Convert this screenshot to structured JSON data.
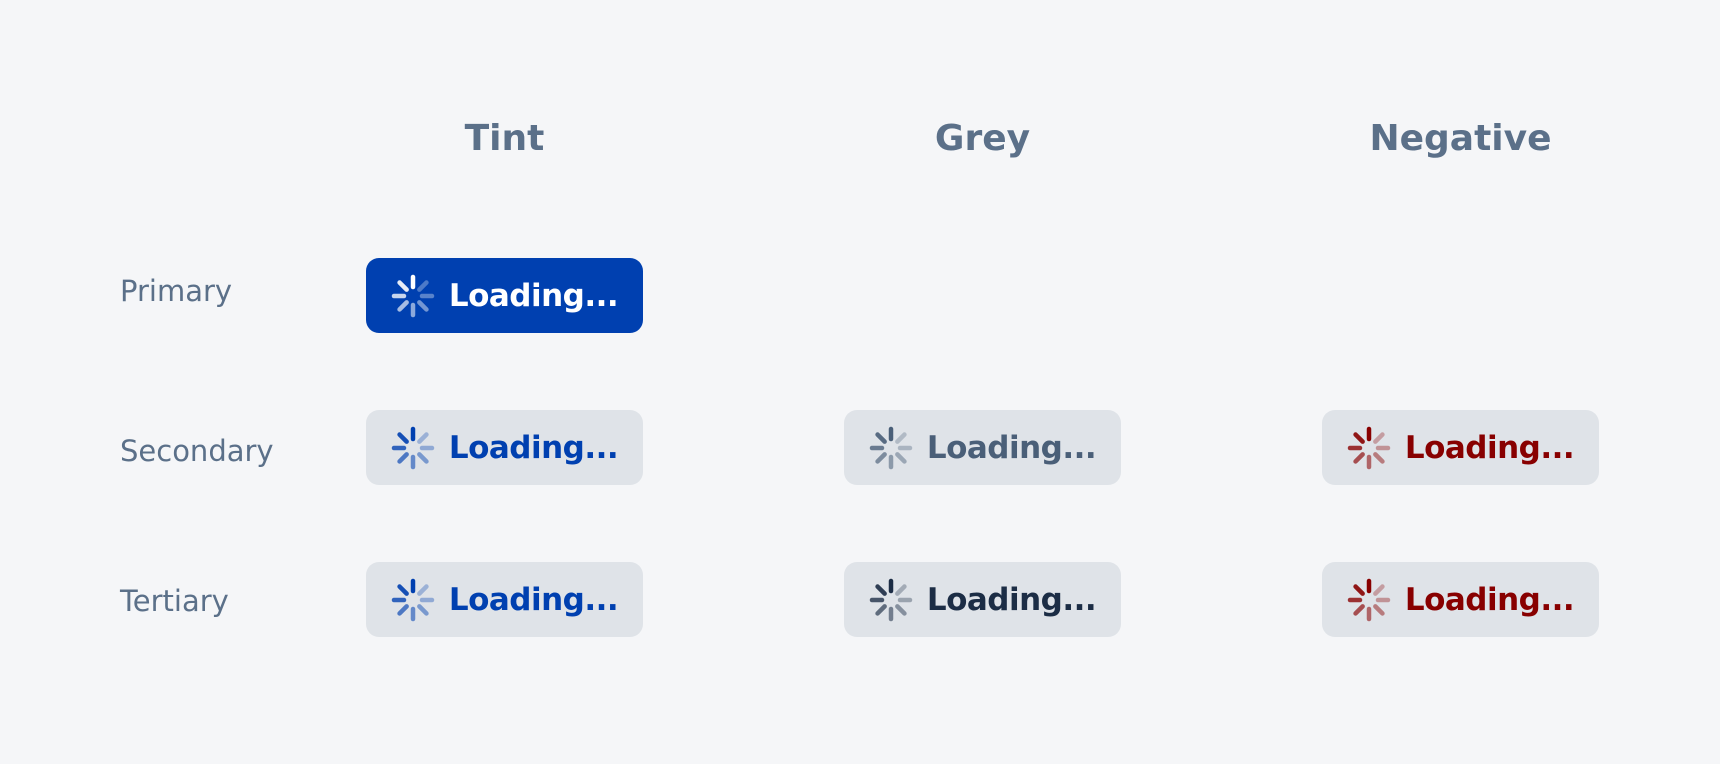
{
  "columns": [
    "Tint",
    "Grey",
    "Negative"
  ],
  "rows": [
    "Primary",
    "Secondary",
    "Tertiary"
  ],
  "buttons": {
    "primary_tint": {
      "label": "Loading...",
      "text_color": "#ffffff",
      "spinner_color": "#ffffff",
      "bg": "#0040b0"
    },
    "secondary_tint": {
      "label": "Loading...",
      "text_color": "#0040b0",
      "spinner_color": "#0040b0",
      "bg": "#dfe3e8"
    },
    "secondary_grey": {
      "label": "Loading...",
      "text_color": "#4a5f78",
      "spinner_color": "#4a5f78",
      "bg": "#dfe3e8"
    },
    "secondary_negative": {
      "label": "Loading...",
      "text_color": "#880000",
      "spinner_color": "#880000",
      "bg": "#dfe3e8"
    },
    "tertiary_tint": {
      "label": "Loading...",
      "text_color": "#0040b0",
      "spinner_color": "#0040b0",
      "bg": "#dfe3e8"
    },
    "tertiary_grey": {
      "label": "Loading...",
      "text_color": "#1c2d45",
      "spinner_color": "#1c2d45",
      "bg": "#dfe3e8"
    },
    "tertiary_negative": {
      "label": "Loading...",
      "text_color": "#880000",
      "spinner_color": "#880000",
      "bg": "#dfe3e8"
    }
  },
  "icons": {
    "spinner": "loading-spinner-icon"
  }
}
